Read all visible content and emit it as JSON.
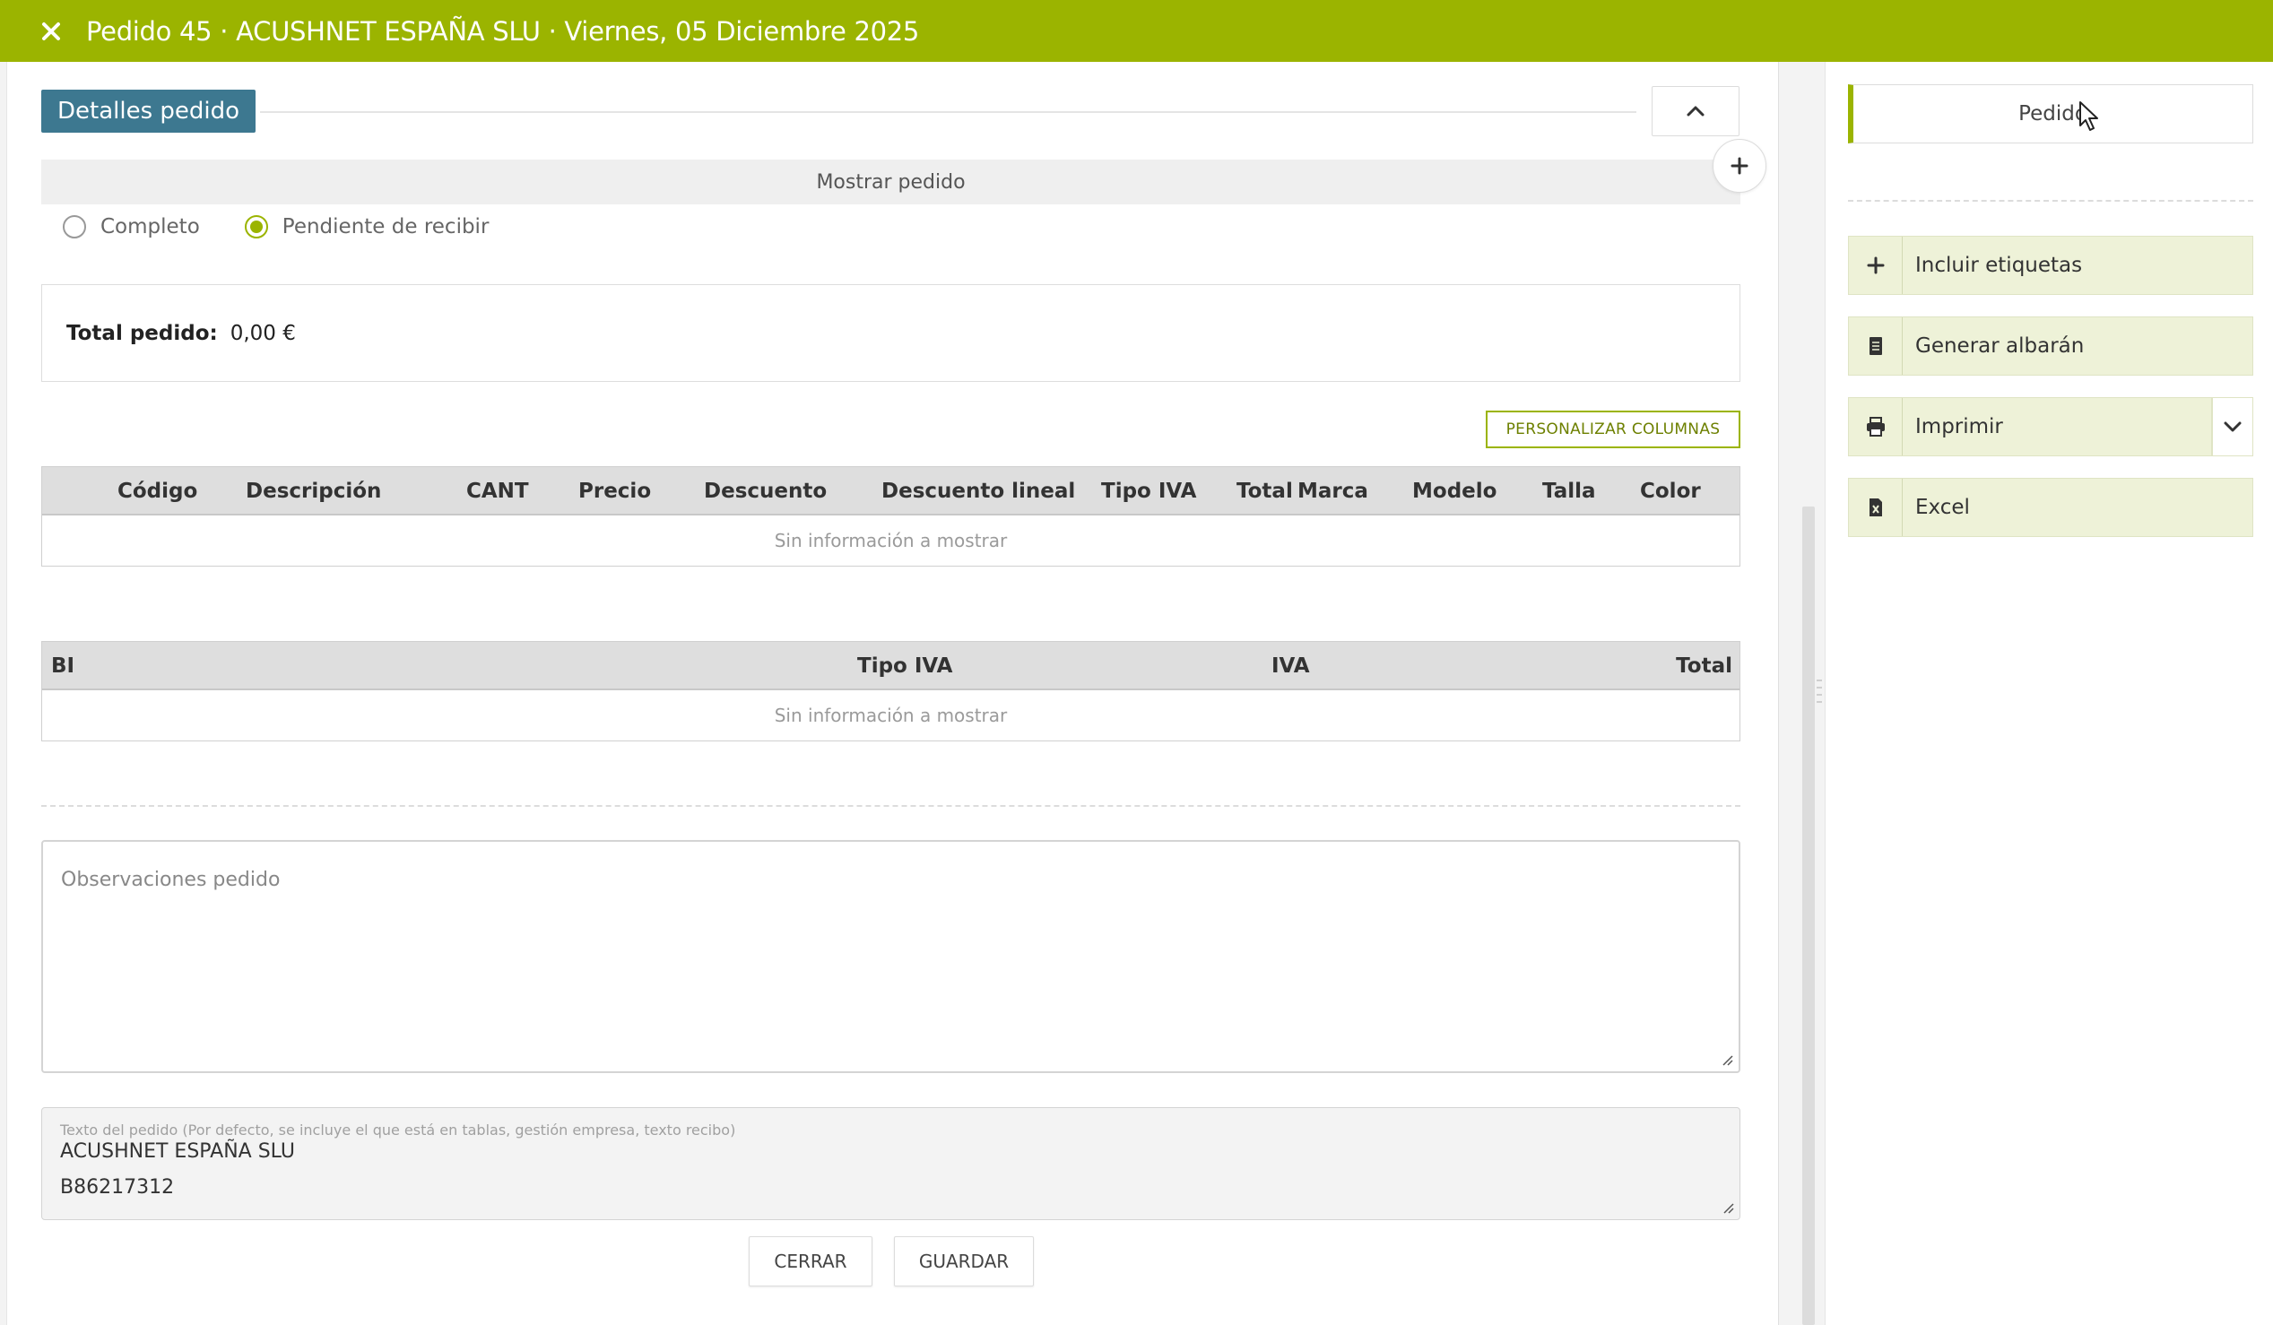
{
  "header": {
    "title": "Pedido 45 · ACUSHNET ESPAÑA SLU · Viernes, 05 Diciembre 2025",
    "close_icon": "close-icon",
    "bg_color": "#9bb400"
  },
  "details": {
    "section_label": "Detalles pedido",
    "show_label": "Mostrar pedido",
    "radio_options": [
      {
        "label": "Completo",
        "checked": false
      },
      {
        "label": "Pendiente de recibir",
        "checked": true
      }
    ],
    "total_label": "Total pedido:",
    "total_value": "0,00 €",
    "customize_columns": "PERSONALIZAR COLUMNAS"
  },
  "lines_table": {
    "columns": [
      "Código",
      "Descripción",
      "CANT",
      "Precio",
      "Descuento",
      "Descuento lineal",
      "Tipo IVA",
      "Total",
      "Marca",
      "Modelo",
      "Talla",
      "Color"
    ],
    "empty_text": "Sin información a mostrar"
  },
  "tax_table": {
    "columns": [
      "BI",
      "Tipo IVA",
      "IVA",
      "Total"
    ],
    "empty_text": "Sin información a mostrar"
  },
  "observations": {
    "placeholder": "Observaciones pedido"
  },
  "order_text": {
    "hint": "Texto del pedido (Por defecto, se incluye el que está en tablas, gestión empresa, texto recibo)",
    "line1": "ACUSHNET ESPAÑA SLU",
    "line2": "B86217312"
  },
  "footer": {
    "close_label": "CERRAR",
    "save_label": "GUARDAR"
  },
  "sidebar": {
    "pedido_label": "Pedido",
    "actions": [
      {
        "label": "Incluir etiquetas",
        "icon": "plus-icon"
      },
      {
        "label": "Generar albarán",
        "icon": "document-icon"
      },
      {
        "label": "Imprimir",
        "icon": "printer-icon"
      },
      {
        "label": "Excel",
        "icon": "excel-file-icon"
      }
    ],
    "accent_color": "#9bb400"
  }
}
